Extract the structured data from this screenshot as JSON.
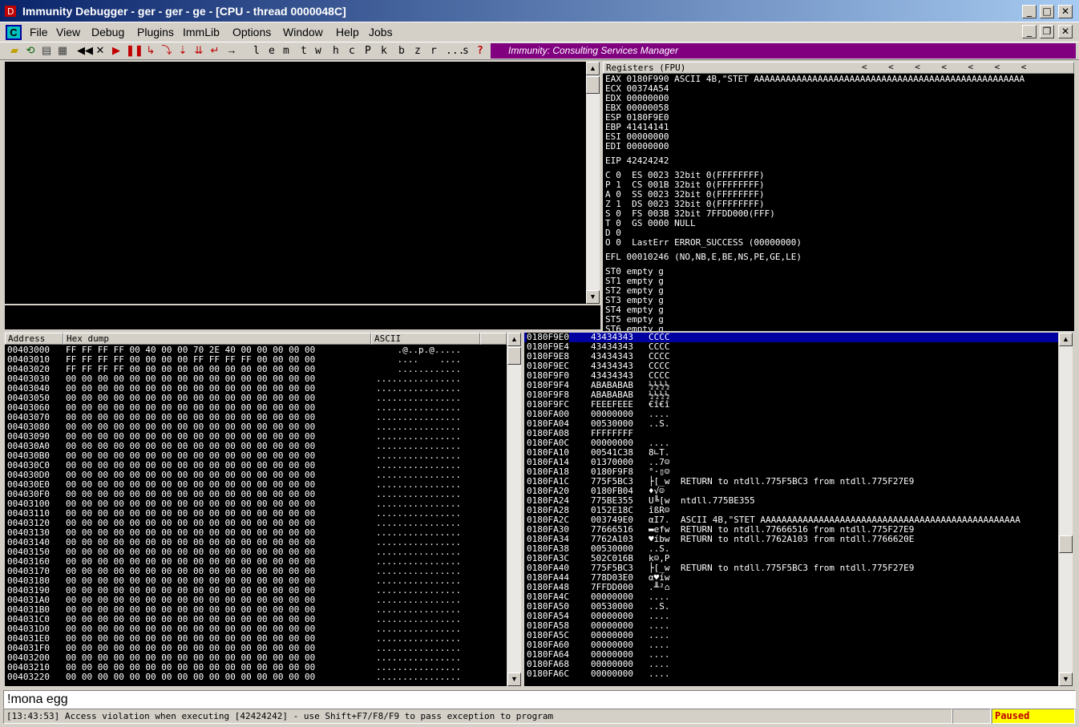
{
  "window": {
    "title": "Immunity Debugger - ger - ger - ge - [CPU - thread 0000048C]",
    "minimize": "_",
    "maximize": "□",
    "close": "✕",
    "child_minimize": "_",
    "child_restore": "❐",
    "child_close": "✕"
  },
  "menu": {
    "mdi_icon": "C",
    "items": [
      "File",
      "View",
      "Debug",
      "Plugins",
      "ImmLib",
      "Options",
      "Window",
      "Help",
      "Jobs"
    ]
  },
  "toolbar": {
    "icons": [
      "open-icon",
      "restart-icon",
      "memory-icon",
      "modules-icon",
      "rewind-icon",
      "close-icon",
      "run-icon",
      "pause-icon",
      "step-into-icon",
      "step-over-icon",
      "trace-into-icon",
      "trace-over-icon",
      "execute-till-return-icon",
      "go-to-icon"
    ],
    "letters": [
      "l",
      "e",
      "m",
      "t",
      "w",
      "h",
      "c",
      "P",
      "k",
      "b",
      "z",
      "r",
      "...",
      "s",
      "?"
    ],
    "banner": "Immunity: Consulting Services Manager",
    "colors": {
      "red": "#c00000",
      "banner_bg": "#800080"
    }
  },
  "registers": {
    "header": "Registers (FPU)",
    "header_arrows": [
      "<",
      "<",
      "<",
      "<",
      "<",
      "<",
      "<"
    ],
    "lines": [
      "EAX 0180F990 ASCII 4B,\"STET AAAAAAAAAAAAAAAAAAAAAAAAAAAAAAAAAAAAAAAAAAAAAAAAAAA",
      "ECX 00374A54",
      "EDX 00000000",
      "EBX 00000058",
      "ESP 0180F9E0",
      "EBP 41414141",
      "ESI 00000000",
      "EDI 00000000",
      "",
      "EIP 42424242",
      "",
      "C 0  ES 0023 32bit 0(FFFFFFFF)",
      "P 1  CS 001B 32bit 0(FFFFFFFF)",
      "A 0  SS 0023 32bit 0(FFFFFFFF)",
      "Z 1  DS 0023 32bit 0(FFFFFFFF)",
      "S 0  FS 003B 32bit 7FFDD000(FFF)",
      "T 0  GS 0000 NULL",
      "D 0",
      "O 0  LastErr ERROR_SUCCESS (00000000)",
      "",
      "EFL 00010246 (NO,NB,E,BE,NS,PE,GE,LE)",
      "",
      "ST0 empty g",
      "ST1 empty g",
      "ST2 empty g",
      "ST3 empty g",
      "ST4 empty g",
      "ST5 empty g",
      "ST6 empty g"
    ]
  },
  "dump": {
    "headers": [
      "Address",
      "Hex dump",
      "ASCII"
    ],
    "rows": [
      [
        "00403000",
        "FF FF FF FF 00 40 00 00 70 2E 40 00 00 00 00 00",
        "    .@..p.@....."
      ],
      [
        "00403010",
        "FF FF FF FF 00 00 00 00 FF FF FF FF 00 00 00 00",
        "    ....    ...."
      ],
      [
        "00403020",
        "FF FF FF FF 00 00 00 00 00 00 00 00 00 00 00 00",
        "    ............"
      ],
      [
        "00403030",
        "00 00 00 00 00 00 00 00 00 00 00 00 00 00 00 00",
        "................"
      ],
      [
        "00403040",
        "00 00 00 00 00 00 00 00 00 00 00 00 00 00 00 00",
        "................"
      ],
      [
        "00403050",
        "00 00 00 00 00 00 00 00 00 00 00 00 00 00 00 00",
        "................"
      ],
      [
        "00403060",
        "00 00 00 00 00 00 00 00 00 00 00 00 00 00 00 00",
        "................"
      ],
      [
        "00403070",
        "00 00 00 00 00 00 00 00 00 00 00 00 00 00 00 00",
        "................"
      ],
      [
        "00403080",
        "00 00 00 00 00 00 00 00 00 00 00 00 00 00 00 00",
        "................"
      ],
      [
        "00403090",
        "00 00 00 00 00 00 00 00 00 00 00 00 00 00 00 00",
        "................"
      ],
      [
        "004030A0",
        "00 00 00 00 00 00 00 00 00 00 00 00 00 00 00 00",
        "................"
      ],
      [
        "004030B0",
        "00 00 00 00 00 00 00 00 00 00 00 00 00 00 00 00",
        "................"
      ],
      [
        "004030C0",
        "00 00 00 00 00 00 00 00 00 00 00 00 00 00 00 00",
        "................"
      ],
      [
        "004030D0",
        "00 00 00 00 00 00 00 00 00 00 00 00 00 00 00 00",
        "................"
      ],
      [
        "004030E0",
        "00 00 00 00 00 00 00 00 00 00 00 00 00 00 00 00",
        "................"
      ],
      [
        "004030F0",
        "00 00 00 00 00 00 00 00 00 00 00 00 00 00 00 00",
        "................"
      ],
      [
        "00403100",
        "00 00 00 00 00 00 00 00 00 00 00 00 00 00 00 00",
        "................"
      ],
      [
        "00403110",
        "00 00 00 00 00 00 00 00 00 00 00 00 00 00 00 00",
        "................"
      ],
      [
        "00403120",
        "00 00 00 00 00 00 00 00 00 00 00 00 00 00 00 00",
        "................"
      ],
      [
        "00403130",
        "00 00 00 00 00 00 00 00 00 00 00 00 00 00 00 00",
        "................"
      ],
      [
        "00403140",
        "00 00 00 00 00 00 00 00 00 00 00 00 00 00 00 00",
        "................"
      ],
      [
        "00403150",
        "00 00 00 00 00 00 00 00 00 00 00 00 00 00 00 00",
        "................"
      ],
      [
        "00403160",
        "00 00 00 00 00 00 00 00 00 00 00 00 00 00 00 00",
        "................"
      ],
      [
        "00403170",
        "00 00 00 00 00 00 00 00 00 00 00 00 00 00 00 00",
        "................"
      ],
      [
        "00403180",
        "00 00 00 00 00 00 00 00 00 00 00 00 00 00 00 00",
        "................"
      ],
      [
        "00403190",
        "00 00 00 00 00 00 00 00 00 00 00 00 00 00 00 00",
        "................"
      ],
      [
        "004031A0",
        "00 00 00 00 00 00 00 00 00 00 00 00 00 00 00 00",
        "................"
      ],
      [
        "004031B0",
        "00 00 00 00 00 00 00 00 00 00 00 00 00 00 00 00",
        "................"
      ],
      [
        "004031C0",
        "00 00 00 00 00 00 00 00 00 00 00 00 00 00 00 00",
        "................"
      ],
      [
        "004031D0",
        "00 00 00 00 00 00 00 00 00 00 00 00 00 00 00 00",
        "................"
      ],
      [
        "004031E0",
        "00 00 00 00 00 00 00 00 00 00 00 00 00 00 00 00",
        "................"
      ],
      [
        "004031F0",
        "00 00 00 00 00 00 00 00 00 00 00 00 00 00 00 00",
        "................"
      ],
      [
        "00403200",
        "00 00 00 00 00 00 00 00 00 00 00 00 00 00 00 00",
        "................"
      ],
      [
        "00403210",
        "00 00 00 00 00 00 00 00 00 00 00 00 00 00 00 00",
        "................"
      ],
      [
        "00403220",
        "00 00 00 00 00 00 00 00 00 00 00 00 00 00 00 00",
        "................"
      ]
    ]
  },
  "stack": {
    "rows": [
      [
        "0180F9E0",
        "43434343",
        "CCCC",
        ""
      ],
      [
        "0180F9E4",
        "43434343",
        "CCCC",
        ""
      ],
      [
        "0180F9E8",
        "43434343",
        "CCCC",
        ""
      ],
      [
        "0180F9EC",
        "43434343",
        "CCCC",
        ""
      ],
      [
        "0180F9F0",
        "43434343",
        "CCCC",
        ""
      ],
      [
        "0180F9F4",
        "ABABABAB",
        "½½½½",
        ""
      ],
      [
        "0180F9F8",
        "ABABABAB",
        "½½½½",
        ""
      ],
      [
        "0180F9FC",
        "FEEEFEEE",
        "€î€î",
        ""
      ],
      [
        "0180FA00",
        "00000000",
        "....",
        ""
      ],
      [
        "0180FA04",
        "00530000",
        "..S.",
        ""
      ],
      [
        "0180FA08",
        "FFFFFFFF",
        "    ",
        ""
      ],
      [
        "0180FA0C",
        "00000000",
        "....",
        ""
      ],
      [
        "0180FA10",
        "00541C38",
        "8∟T.",
        ""
      ],
      [
        "0180FA14",
        "01370000",
        "..7☺",
        ""
      ],
      [
        "0180FA18",
        "0180F9F8",
        "°·▯☺",
        ""
      ],
      [
        "0180FA1C",
        "775F5BC3",
        "├[_w",
        "RETURN to ntdll.775F5BC3 from ntdll.775F27E9"
      ],
      [
        "0180FA20",
        "0180FB04",
        "♦√☺",
        ""
      ],
      [
        "0180FA24",
        "775BE355",
        "U╚[w",
        "ntdll.775BE355"
      ],
      [
        "0180FA28",
        "0152E18C",
        "îßR☺",
        ""
      ],
      [
        "0180FA2C",
        "003749E0",
        "αI7.",
        "ASCII 4B,\"STET AAAAAAAAAAAAAAAAAAAAAAAAAAAAAAAAAAAAAAAAAAAAAAAAA"
      ],
      [
        "0180FA30",
        "77666516",
        "▬efw",
        "RETURN to ntdll.77666516 from ntdll.775F27E9"
      ],
      [
        "0180FA34",
        "7762A103",
        "♥íbw",
        "RETURN to ntdll.7762A103 from ntdll.7766620E"
      ],
      [
        "0180FA38",
        "00530000",
        "..S.",
        ""
      ],
      [
        "0180FA3C",
        "502C016B",
        "k☺,P",
        ""
      ],
      [
        "0180FA40",
        "775F5BC3",
        "├[_w",
        "RETURN to ntdll.775F5BC3 from ntdll.775F27E9"
      ],
      [
        "0180FA44",
        "778D03E0",
        "α♥íw",
        ""
      ],
      [
        "0180FA48",
        "7FFDD000",
        ".╨²⌂",
        ""
      ],
      [
        "0180FA4C",
        "00000000",
        "....",
        ""
      ],
      [
        "0180FA50",
        "00530000",
        "..S.",
        ""
      ],
      [
        "0180FA54",
        "00000000",
        "....",
        ""
      ],
      [
        "0180FA58",
        "00000000",
        "....",
        ""
      ],
      [
        "0180FA5C",
        "00000000",
        "....",
        ""
      ],
      [
        "0180FA60",
        "00000000",
        "....",
        ""
      ],
      [
        "0180FA64",
        "00000000",
        "....",
        ""
      ],
      [
        "0180FA68",
        "00000000",
        "....",
        ""
      ],
      [
        "0180FA6C",
        "00000000",
        "....",
        ""
      ]
    ],
    "selected_row": 0
  },
  "command": {
    "value": "!mona egg"
  },
  "status": {
    "message": "[13:43:53] Access violation when executing [42424242] - use Shift+F7/F8/F9 to pass exception to program",
    "state": "Paused"
  }
}
